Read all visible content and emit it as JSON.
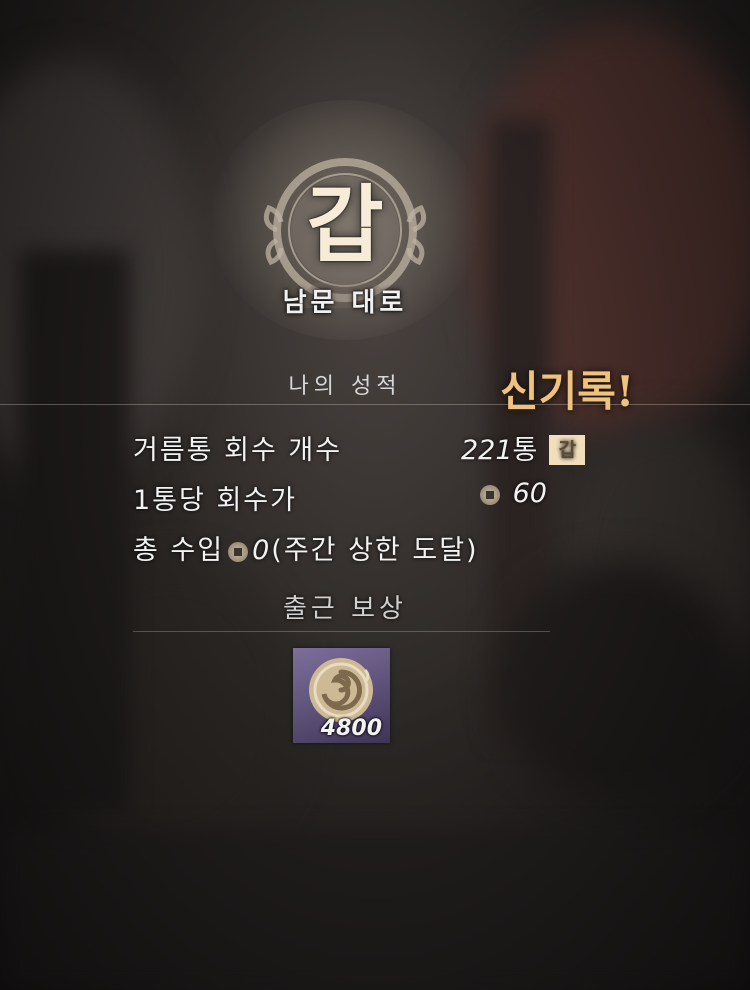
{
  "result": {
    "grade": "갑",
    "area_name": "남문 대로",
    "section_title": "나의 성적",
    "new_record": "신기록!"
  },
  "stats": {
    "fertilizer_label": "거름통 회수 개수",
    "fertilizer_count": "221",
    "fertilizer_unit": "통",
    "fertilizer_grade": "갑",
    "per_unit_label": "1통당 회수가",
    "per_unit_value": "60",
    "total_label": "총 수입",
    "total_value": "0",
    "total_note": "(주간 상한 도달)"
  },
  "reward": {
    "title": "출근 보상",
    "item_icon": "swirl-token-icon",
    "item_quantity": "4800"
  },
  "colors": {
    "new_record": "#efc27d",
    "grade_badge_bg": "#f1dfbc",
    "reward_item_bg": "#5d5078"
  }
}
